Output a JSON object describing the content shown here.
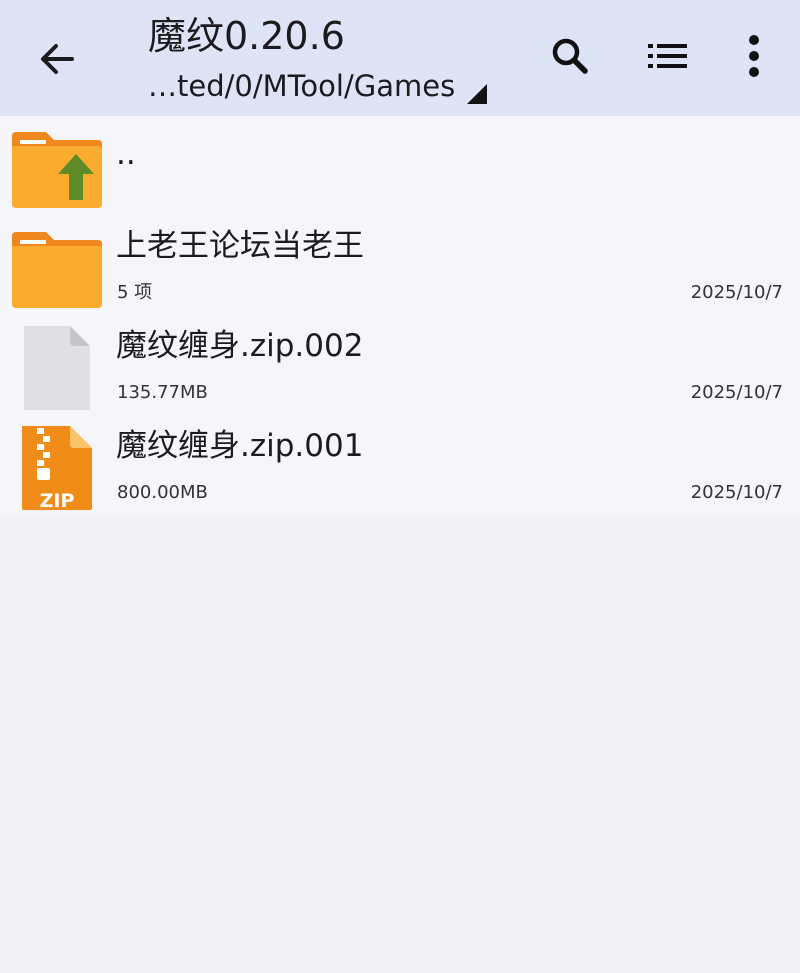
{
  "toolbar": {
    "back_icon": "arrow-left-icon",
    "title": "魔纹0.20.6",
    "path": "…ted/0/MTool/Games",
    "search_icon": "search-icon",
    "list_view_icon": "list-view-icon",
    "more_icon": "more-vert-icon"
  },
  "files": [
    {
      "name": "..",
      "icon": "parent-folder-icon"
    },
    {
      "name": "上老王论坛当老王",
      "meta": "5 项",
      "date": "2025/10/7",
      "icon": "folder-icon"
    },
    {
      "name": "魔纹缠身.zip.002",
      "meta": "135.77MB",
      "date": "2025/10/7",
      "icon": "file-icon"
    },
    {
      "name": "魔纹缠身.zip.001",
      "meta": "800.00MB",
      "date": "2025/10/7",
      "icon": "zip-file-icon",
      "icon_label": "ZIP"
    }
  ],
  "colors": {
    "toolbar_bg": "#dfe3f6",
    "page_bg": "#f3f2f7",
    "folder": "#fbab2d",
    "folder_tab": "#f0881e",
    "zip": "#f08c18",
    "up_arrow": "#5e8b26"
  }
}
